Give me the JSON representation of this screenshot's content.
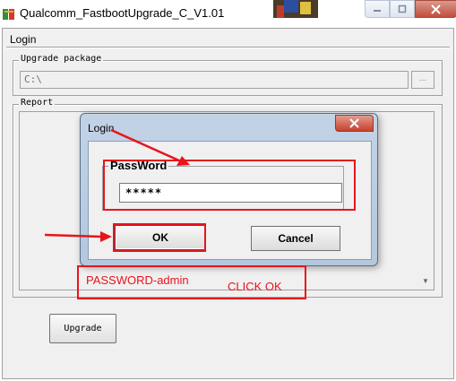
{
  "window": {
    "title": "Qualcomm_FastbootUpgrade_C_V1.01",
    "menu_label": "Login"
  },
  "upgrade_package": {
    "group_title": "Upgrade package",
    "path_value": "C:\\",
    "browse_label": "..."
  },
  "report": {
    "group_title": "Report"
  },
  "upgrade_button": {
    "label": "Upgrade"
  },
  "login_dialog": {
    "title": "Login",
    "password_group_title": "PassWord",
    "password_value": "*****",
    "ok_label": "OK",
    "cancel_label": "Cancel"
  },
  "annotations": {
    "password_hint": "PASSWORD-admin",
    "click_hint": "CLICK OK",
    "color": "#e8141c"
  },
  "icons": {
    "app": "app-icon",
    "minimize": "minimize-icon",
    "maximize": "maximize-icon",
    "close": "close-icon",
    "dialog_close": "close-icon"
  }
}
